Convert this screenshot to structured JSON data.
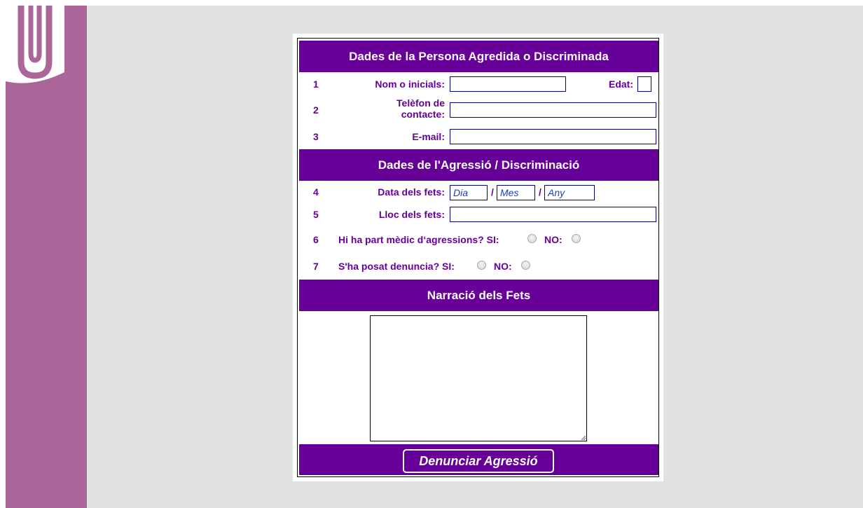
{
  "colors": {
    "accent": "#660099",
    "side_bar": "#aa6699",
    "page_background": "#e2e2e2"
  },
  "logo": {
    "icon": "paperclip-icon"
  },
  "section1": {
    "title": "Dades de la Persona Agredida o Discriminada",
    "rows": [
      {
        "num": "1",
        "label": "Nom o inicials:",
        "value": "",
        "extra_label": "Edat:",
        "extra_value": ""
      },
      {
        "num": "2",
        "label_line1": "Telèfon de",
        "label_line2": "contacte:",
        "value": ""
      },
      {
        "num": "3",
        "label": "E-mail:",
        "value": ""
      }
    ]
  },
  "section2": {
    "title": "Dades de l'Agressió / Discriminació",
    "date_row": {
      "num": "4",
      "label": "Data dels fets:",
      "day_placeholder": "Dia",
      "month_placeholder": "Mes",
      "year_placeholder": "Any",
      "separator": "/"
    },
    "place_row": {
      "num": "5",
      "label": "Lloc dels fets:",
      "value": ""
    },
    "medical_row": {
      "num": "6",
      "question": "Hi ha part mèdic d‘agressions? SI:",
      "no_label": "NO:"
    },
    "report_row": {
      "num": "7",
      "question": "S'ha posat denuncia? SI:",
      "no_label": "NO:"
    }
  },
  "section3": {
    "title": "Narració dels Fets",
    "narration_value": ""
  },
  "submit": {
    "label": "Denunciar Agressió"
  }
}
